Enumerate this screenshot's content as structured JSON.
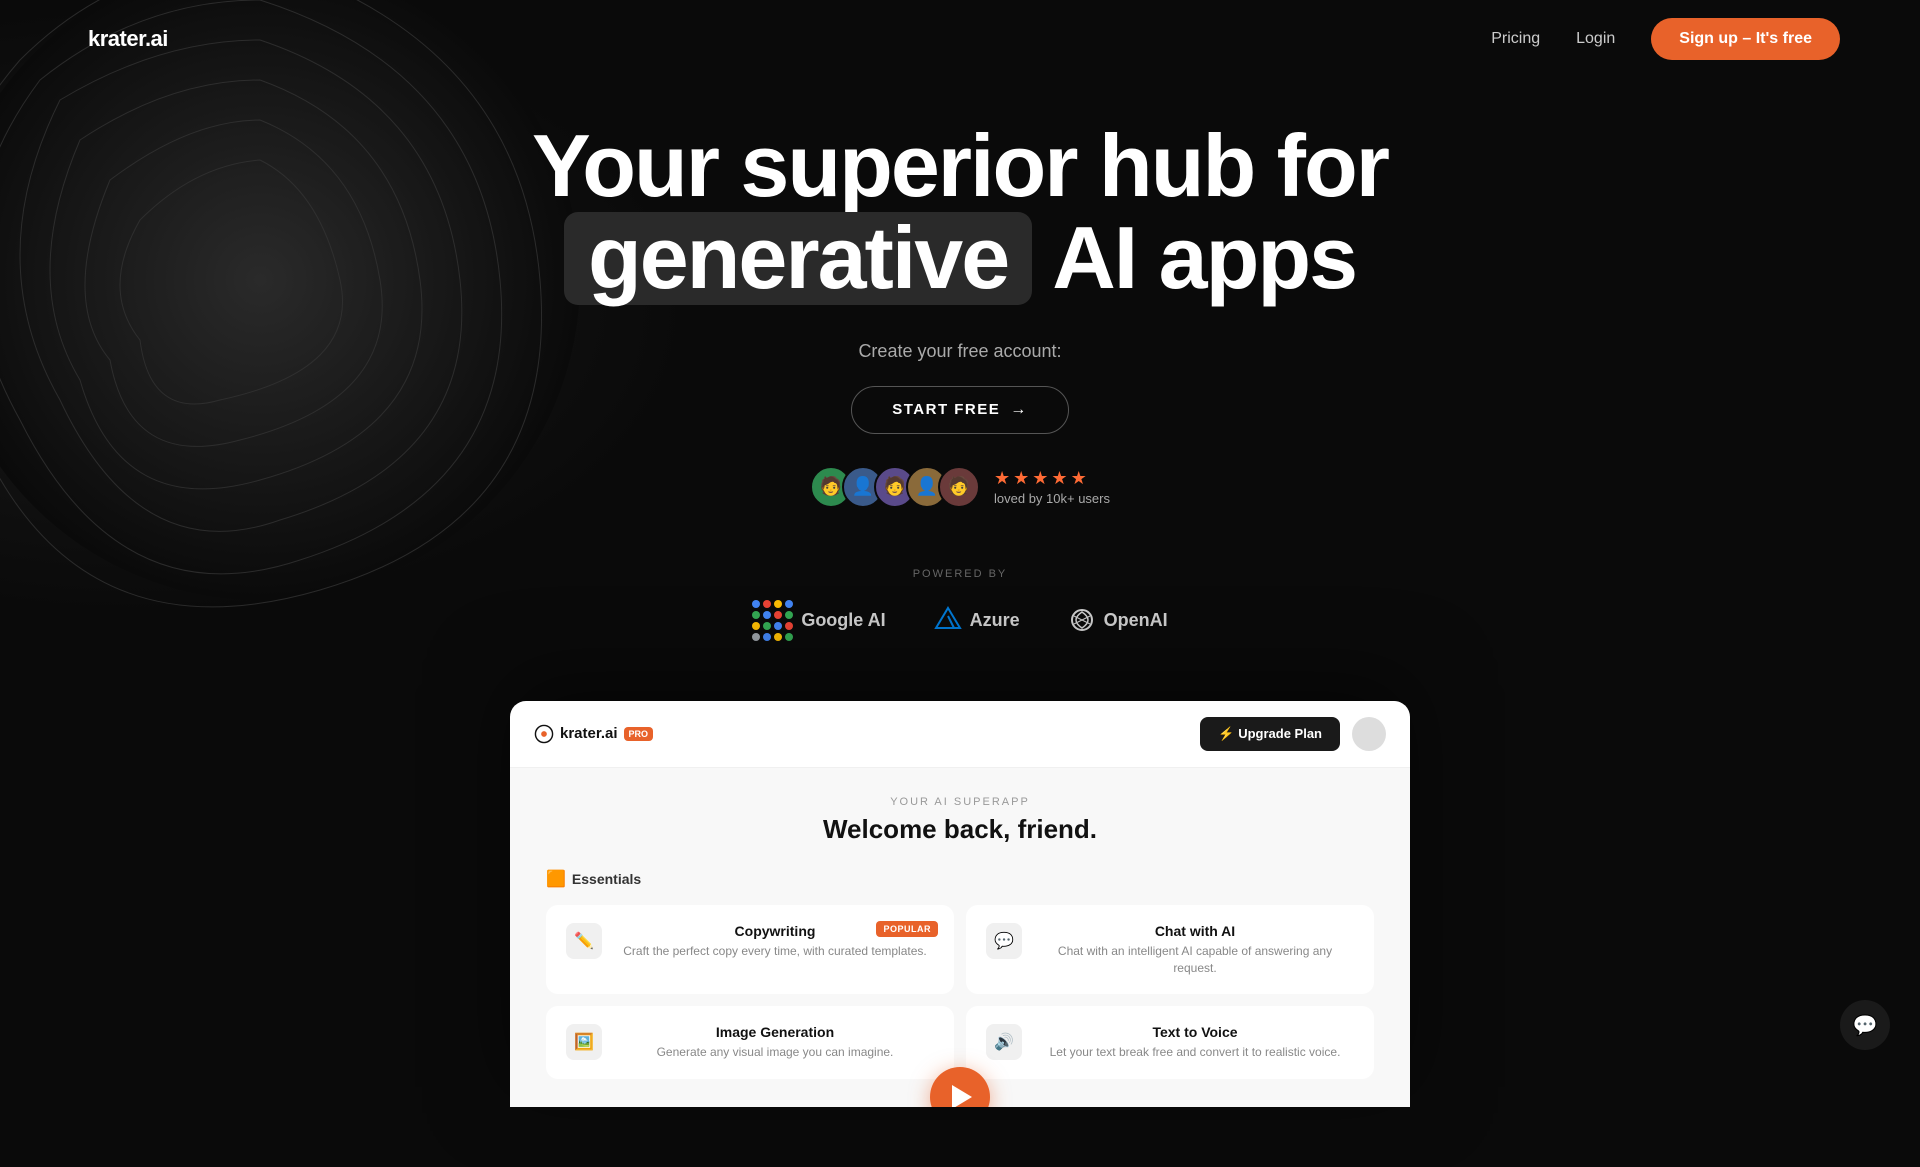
{
  "nav": {
    "logo_text": "krater.ai",
    "pricing_label": "Pricing",
    "login_label": "Login",
    "signup_label": "Sign up – It's free"
  },
  "hero": {
    "title_line1": "Your superior hub for",
    "title_highlight": "genera",
    "title_suffix": "tive AI apps",
    "subtitle": "Create your free account:",
    "cta_label": "START  FREE",
    "social_proof": "loved by 10k+ users",
    "stars": [
      "★",
      "★",
      "★",
      "★",
      "★"
    ]
  },
  "powered": {
    "label": "POWERED BY",
    "logos": [
      {
        "name": "Google AI"
      },
      {
        "name": "Azure"
      },
      {
        "name": "OpenAI"
      }
    ]
  },
  "app": {
    "logo": "krater.ai",
    "badge": "PRO",
    "upgrade_label": "⚡ Upgrade Plan",
    "superapp_label": "YOUR AI SUPERAPP",
    "welcome": "Welcome back, friend.",
    "essentials_label": "Essentials",
    "tools": [
      {
        "name": "Copywriting",
        "desc": "Craft the perfect copy every time, with curated templates.",
        "icon": "✏️",
        "popular": true
      },
      {
        "name": "Chat with AI",
        "desc": "Chat with an intelligent AI capable of answering any request.",
        "icon": "💬",
        "popular": false
      },
      {
        "name": "Image Generation",
        "desc": "Generate any visual image you can imagine.",
        "icon": "🖼️",
        "popular": false
      },
      {
        "name": "Text to Voice",
        "desc": "Let your text break free and convert it to realistic voice.",
        "icon": "🔊",
        "popular": false
      }
    ]
  }
}
